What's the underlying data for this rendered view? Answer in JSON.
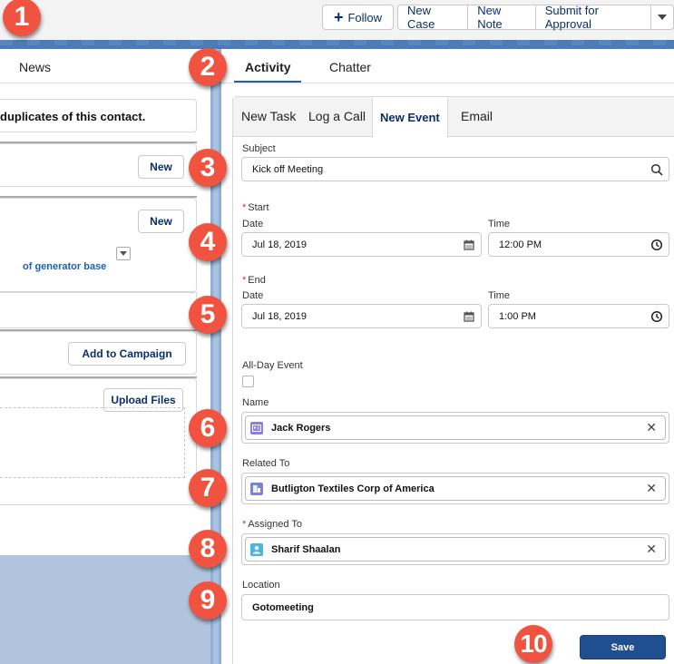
{
  "header": {
    "follow_label": "Follow",
    "actions": [
      "New Case",
      "New Note",
      "Submit for Approval"
    ]
  },
  "left": {
    "tab_news": "News",
    "duplicate_message": "duplicates of this contact.",
    "new_button_1": "New",
    "new_button_2": "New",
    "link_text": "of generator base",
    "add_to_campaign": "Add to Campaign",
    "upload_files": "Upload Files"
  },
  "tabs": {
    "activity": "Activity",
    "chatter": "Chatter"
  },
  "composer": {
    "subtabs": [
      "New Task",
      "Log a Call",
      "New Event",
      "Email"
    ],
    "active_subtab": "New Event",
    "subject": {
      "label": "Subject",
      "value": "Kick off Meeting"
    },
    "start": {
      "label": "Start",
      "date_label": "Date",
      "date": "Jul 18, 2019",
      "time_label": "Time",
      "time": "12:00 PM"
    },
    "end": {
      "label": "End",
      "date_label": "Date",
      "date": "Jul 18, 2019",
      "time_label": "Time",
      "time": "1:00 PM"
    },
    "all_day": {
      "label": "All-Day Event",
      "checked": false
    },
    "name": {
      "label": "Name",
      "value": "Jack Rogers"
    },
    "related_to": {
      "label": "Related To",
      "value": "Butligton Textiles Corp of America"
    },
    "assigned_to": {
      "label": "Assigned To",
      "value": "Sharif Shaalan"
    },
    "location": {
      "label": "Location",
      "value": "Gotomeeting"
    },
    "save_label": "Save",
    "required_mark": "*"
  },
  "callouts": [
    "1",
    "2",
    "3",
    "4",
    "5",
    "6",
    "7",
    "8",
    "9",
    "10"
  ],
  "colors": {
    "accent": "#1b5fb6",
    "save_button": "#1f4f8f",
    "callout": "#f0533f",
    "contact_icon": "#8b7fe0",
    "account_icon": "#7b83d8",
    "user_icon": "#4bb6e6"
  }
}
